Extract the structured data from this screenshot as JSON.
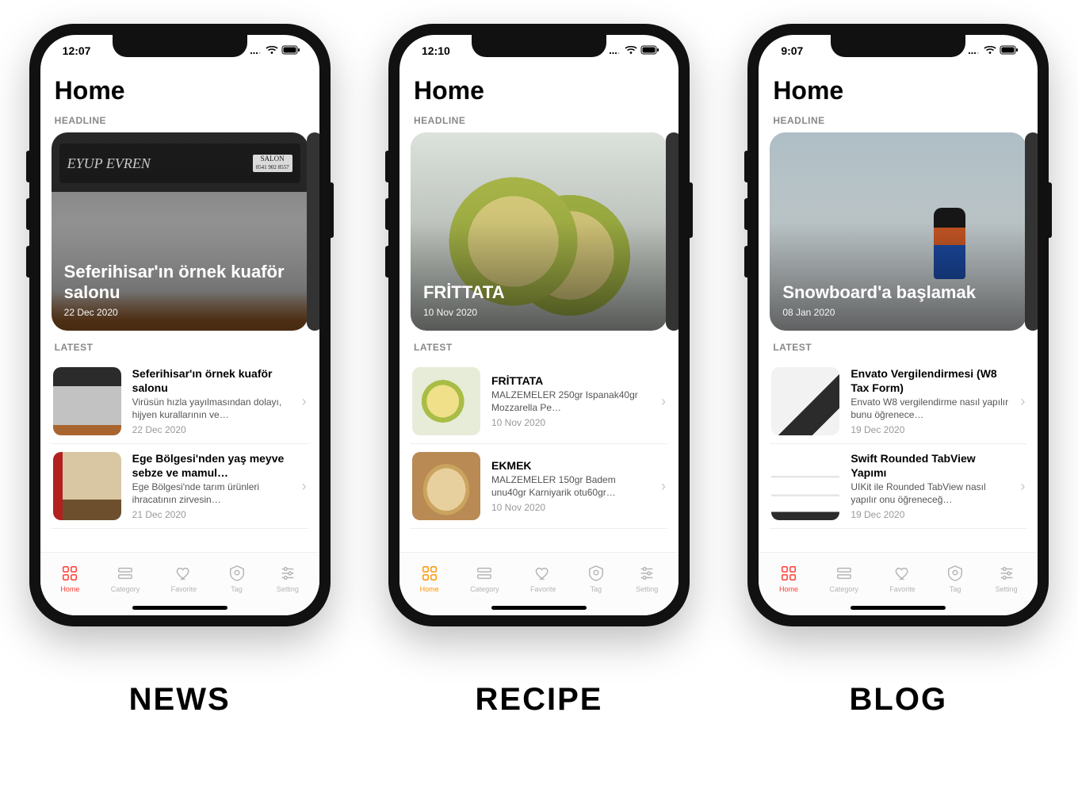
{
  "phones": [
    {
      "label": "NEWS",
      "accent": "#ff3b30",
      "status": {
        "time": "12:07"
      },
      "page_title": "Home",
      "section_headline": "HEADLINE",
      "section_latest": "LATEST",
      "headline": {
        "title": "Seferihisar'ın örnek kuaför salonu",
        "date": "22 Dec 2020",
        "bg_class": "bg-storefront",
        "sign_text": "EYUP EVREN",
        "sign_sub1": "SALON",
        "sign_sub2": "0541 902 8557"
      },
      "latest": [
        {
          "title": "Seferihisar'ın örnek kuaför salonu",
          "desc": "Virüsün hızla yayılmasından dolayı, hijyen kurallarının ve…",
          "date": "22 Dec 2020",
          "thumb_class": "thumb-storefront"
        },
        {
          "title": "Ege Bölgesi'nden yaş meyve sebze ve mamul…",
          "desc": "Ege Bölgesi'nde tarım ürünleri ihracatının zirvesin…",
          "date": "21 Dec 2020",
          "thumb_class": "thumb-desk"
        }
      ],
      "tabs": [
        {
          "label": "Home",
          "active": true
        },
        {
          "label": "Category",
          "active": false
        },
        {
          "label": "Favorite",
          "active": false
        },
        {
          "label": "Tag",
          "active": false
        },
        {
          "label": "Setting",
          "active": false
        }
      ]
    },
    {
      "label": "RECIPE",
      "accent": "#ff9500",
      "status": {
        "time": "12:10"
      },
      "page_title": "Home",
      "section_headline": "HEADLINE",
      "section_latest": "LATEST",
      "headline": {
        "title": "FRİTTATA",
        "date": "10 Nov 2020",
        "bg_class": "bg-frittata"
      },
      "latest": [
        {
          "title": "FRİTTATA",
          "desc": "MALZEMELER 250gr Ispanak40gr Mozzarella Pe…",
          "date": "10 Nov 2020",
          "thumb_class": "thumb-frittata"
        },
        {
          "title": "EKMEK",
          "desc": "MALZEMELER 150gr Badem unu40gr Karniyarik otu60gr…",
          "date": "10 Nov 2020",
          "thumb_class": "thumb-bread"
        }
      ],
      "tabs": [
        {
          "label": "Home",
          "active": true
        },
        {
          "label": "Category",
          "active": false
        },
        {
          "label": "Favorite",
          "active": false
        },
        {
          "label": "Tag",
          "active": false
        },
        {
          "label": "Setting",
          "active": false
        }
      ]
    },
    {
      "label": "BLOG",
      "accent": "#ff3b30",
      "status": {
        "time": "9:07"
      },
      "page_title": "Home",
      "section_headline": "HEADLINE",
      "section_latest": "LATEST",
      "headline": {
        "title": "Snowboard'a başlamak",
        "date": "08 Jan 2020",
        "bg_class": "bg-snowboard"
      },
      "latest": [
        {
          "title": "Envato Vergilendirmesi (W8 Tax Form)",
          "desc": "Envato W8 vergilendirme nasıl yapılır bunu öğrenece…",
          "date": "19 Dec 2020",
          "thumb_class": "thumb-calc"
        },
        {
          "title": "Swift Rounded TabView Yapımı",
          "desc": "UIKit ile Rounded TabView nasıl yapılır onu öğreneceğ…",
          "date": "19 Dec 2020",
          "thumb_class": "thumb-tabview"
        }
      ],
      "tabs": [
        {
          "label": "Home",
          "active": true
        },
        {
          "label": "Category",
          "active": false
        },
        {
          "label": "Favorite",
          "active": false
        },
        {
          "label": "Tag",
          "active": false
        },
        {
          "label": "Setting",
          "active": false
        }
      ]
    }
  ]
}
